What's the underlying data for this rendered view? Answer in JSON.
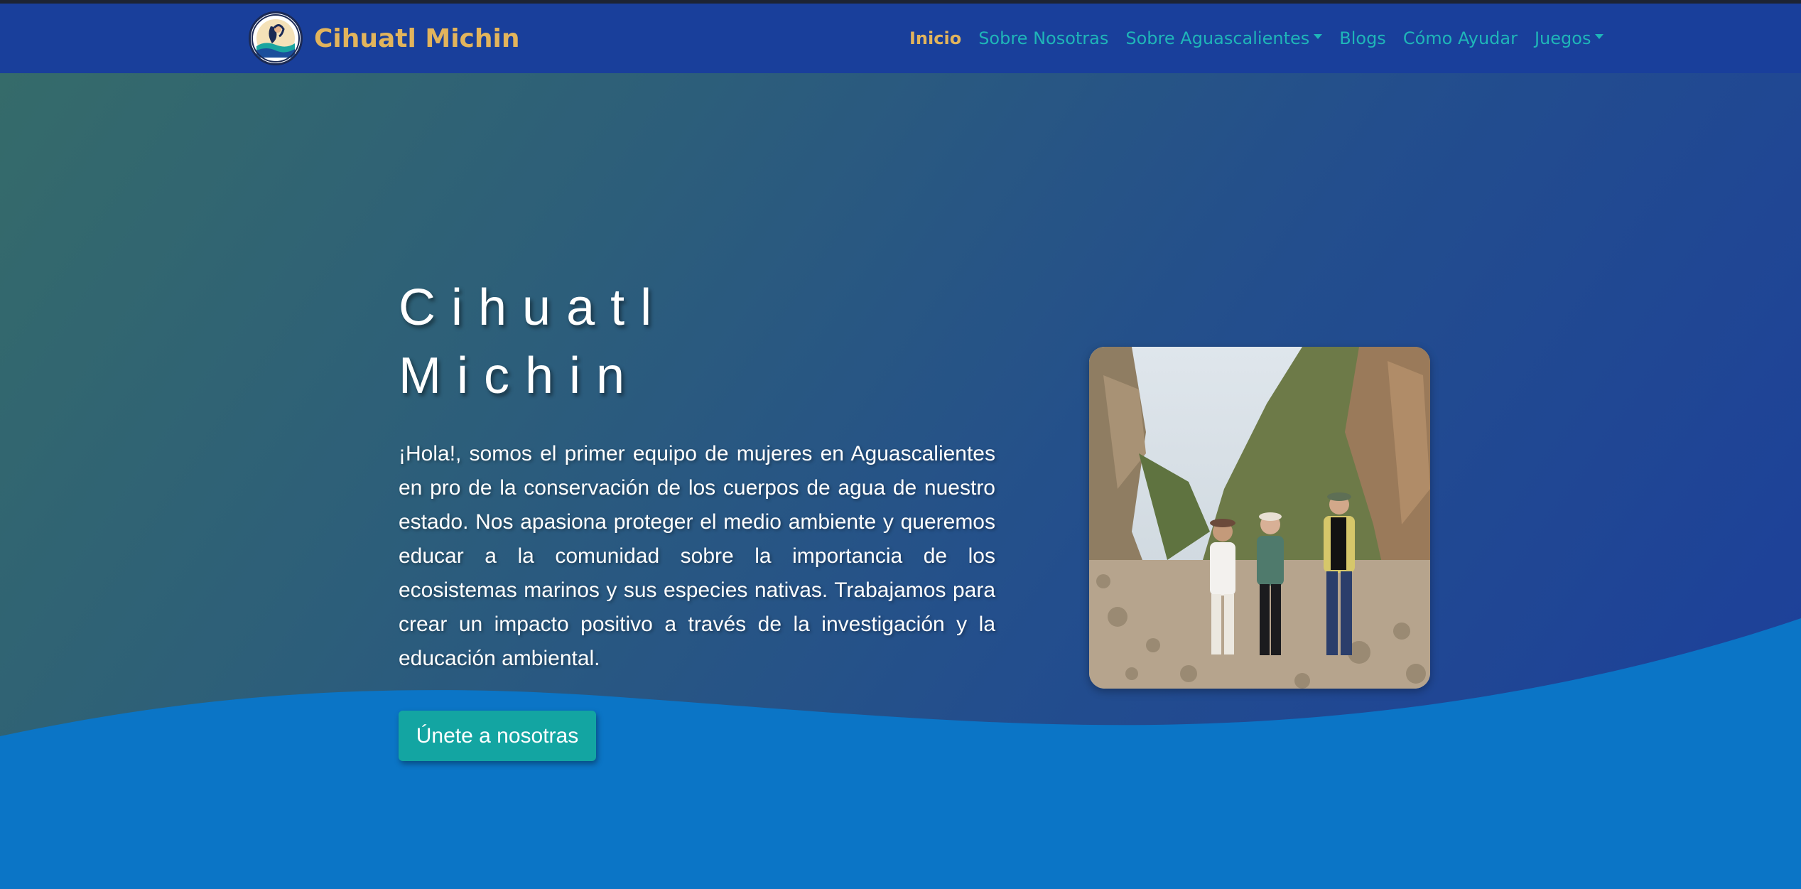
{
  "brand": {
    "name": "Cihuatl Michin",
    "logo_icon": "mermaid-logo-icon"
  },
  "nav": {
    "items": [
      {
        "label": "Inicio",
        "active": true,
        "dropdown": false
      },
      {
        "label": "Sobre Nosotras",
        "active": false,
        "dropdown": false
      },
      {
        "label": "Sobre Aguascalientes",
        "active": false,
        "dropdown": true
      },
      {
        "label": "Blogs",
        "active": false,
        "dropdown": false
      },
      {
        "label": "Cómo Ayudar",
        "active": false,
        "dropdown": false
      },
      {
        "label": "Juegos",
        "active": false,
        "dropdown": true
      }
    ]
  },
  "hero": {
    "title_line1": "Cihuatl",
    "title_line2": "Michin",
    "intro": "¡Hola!, somos el primer equipo de mujeres en Aguascalientes en pro de la conservación de los cuerpos de agua de nuestro estado. Nos apasiona proteger el medio ambiente y queremos educar a la comunidad sobre la importancia de los ecosistemas marinos y sus especies nativas. Trabajamos para crear un impacto positivo a través de la investigación y la educación ambiental.",
    "cta_label": "Únete a nosotras"
  },
  "colors": {
    "navbar": "#193f9b",
    "brand": "#e2b45c",
    "nav_link": "#1fb5b8",
    "wave": "#0b75c6",
    "cta": "#13a5a2"
  }
}
